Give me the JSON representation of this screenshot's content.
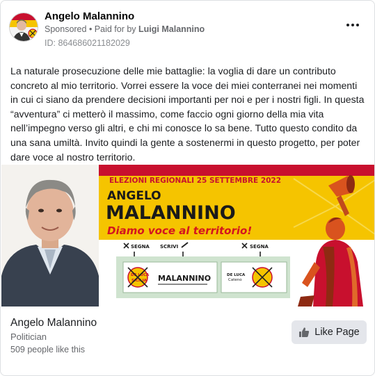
{
  "header": {
    "page_name": "Angelo Malannino",
    "sponsored": "Sponsored",
    "separator": " • ",
    "paid_for_label": "Paid for by ",
    "paid_for_name": "Luigi Malannino",
    "ad_id": "ID: 864686021182029"
  },
  "post": {
    "text": "La naturale prosecuzione delle mie battaglie: la voglia di dare un contributo concreto al mio territorio. Vorrei essere la voce dei miei conterranei nei momenti in cui ci siano da prendere decisioni importanti per noi e per i nostri figli. In questa “avventura” ci metterò il massimo, come faccio ogni giorno della mia vita nell’impegno verso gli altri, e chi mi conosce lo sa bene. Tutto questo condito da una sana umiltà. Invito quindi la gente a sostenermi in questo progetto, per poter dare voce al nostro territorio."
  },
  "banner": {
    "election_line": "ELEZIONI REGIONALI 25 SETTEMBRE 2022",
    "first_name": "ANGELO",
    "last_name": "MALANNINO",
    "slogan": "Diamo voce al territorio!",
    "segna_left": "SEGNA",
    "scrivi": "SCRIVI",
    "segna_right": "SEGNA",
    "ballot_name": "MALANNINO",
    "candidate_small_1": "DE LUCA",
    "candidate_small_2": "Cateno",
    "logo_text_top": "DE LUCA",
    "logo_text_bottom": "SICILIA"
  },
  "footer": {
    "name": "Angelo Malannino",
    "category": "Politician",
    "likes": "509 people like this",
    "like_button": "Like Page"
  },
  "colors": {
    "banner_red": "#c8102e",
    "banner_yellow": "#f5c400",
    "slogan_red": "#d4151f",
    "ballot_green": "#cfe3cf",
    "button_gray": "#e4e6eb"
  }
}
